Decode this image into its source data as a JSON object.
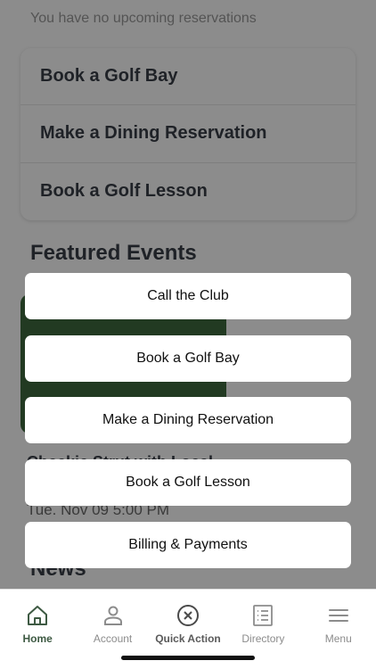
{
  "background": {
    "no_reservations_text": "You have no upcoming reservations",
    "quick_links": [
      "Book a Golf Bay",
      "Make a Dining Reservation",
      "Book a Golf Lesson"
    ],
    "featured_title": "Featured Events",
    "event_title": "Cheekie Strut with Local",
    "event_date": "Tue. Nov 09 5:00 PM",
    "news_title": "News"
  },
  "action_sheet": {
    "items": [
      "Call the Club",
      "Book a Golf Bay",
      "Make a Dining Reservation",
      "Book a Golf Lesson",
      "Billing & Payments"
    ]
  },
  "tabbar": {
    "items": [
      {
        "label": "Home",
        "icon": "home-icon"
      },
      {
        "label": "Account",
        "icon": "person-icon"
      },
      {
        "label": "Quick Action",
        "icon": "close-circle-icon"
      },
      {
        "label": "Directory",
        "icon": "list-icon"
      },
      {
        "label": "Menu",
        "icon": "hamburger-icon"
      }
    ]
  },
  "colors": {
    "accent": "#3e5a43",
    "event_image": "#3f6a3e"
  }
}
